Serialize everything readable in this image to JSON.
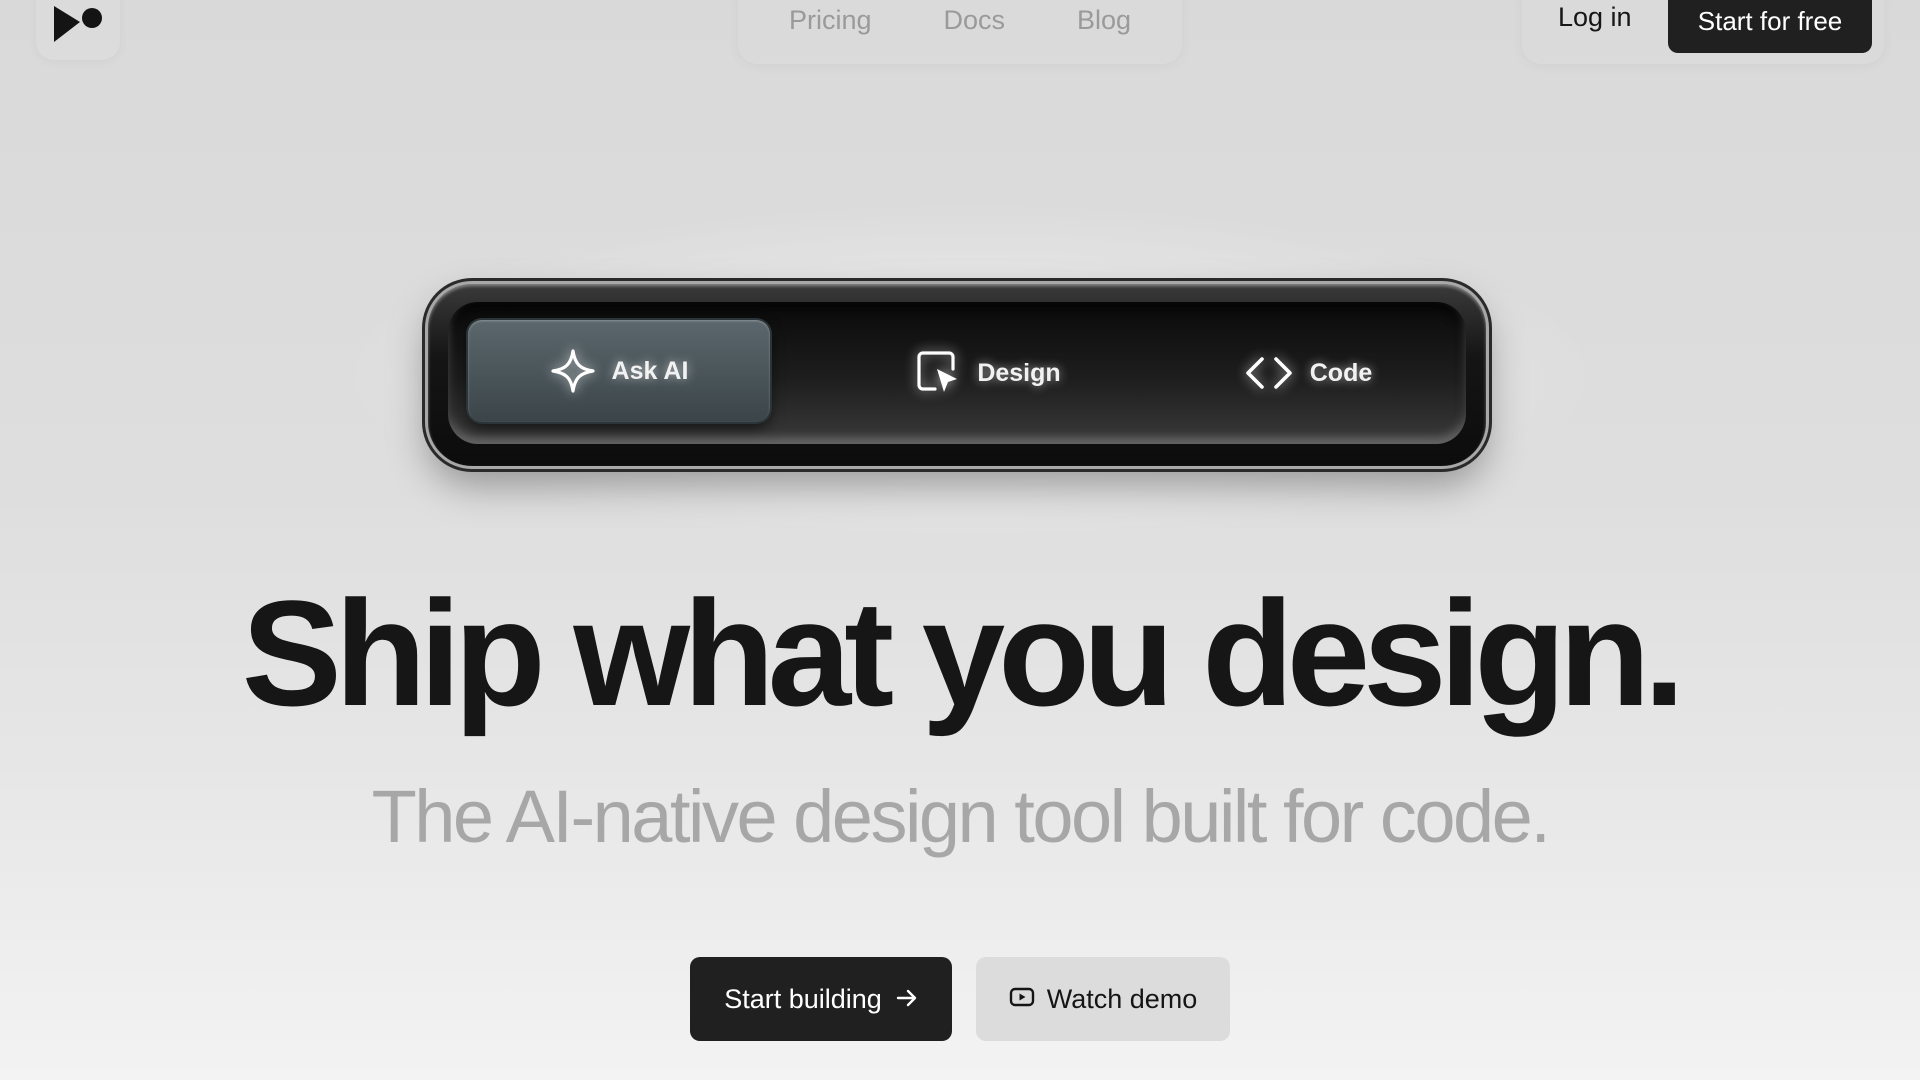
{
  "nav": {
    "links": [
      {
        "label": "Pricing"
      },
      {
        "label": "Docs"
      },
      {
        "label": "Blog"
      }
    ],
    "login_label": "Log in",
    "cta_label": "Start for free"
  },
  "toolbar": {
    "items": [
      {
        "label": "Ask AI",
        "icon": "sparkle-icon",
        "active": true
      },
      {
        "label": "Design",
        "icon": "cursor-frame-icon",
        "active": false
      },
      {
        "label": "Code",
        "icon": "code-brackets-icon",
        "active": false
      }
    ]
  },
  "hero": {
    "headline": "Ship what you design.",
    "subheadline": "The AI-native design tool built for code."
  },
  "cta": {
    "primary_label": "Start building",
    "secondary_label": "Watch demo"
  },
  "colors": {
    "dark_button": "#202020",
    "headline": "#161616",
    "subheadline": "#a7a7a7",
    "nav_link": "#9a9a9a"
  }
}
